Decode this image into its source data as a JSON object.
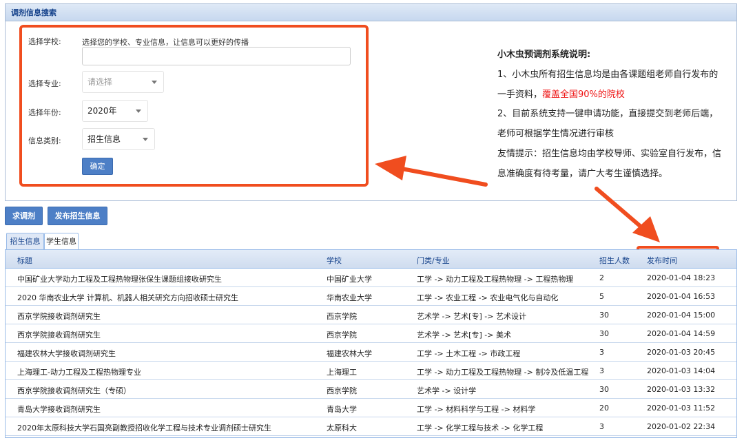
{
  "panel": {
    "title": "调剂信息搜索",
    "hint": "选择您的学校、专业信息，让信息可以更好的传播",
    "labels": {
      "school": "选择学校:",
      "major": "选择专业:",
      "year": "选择年份:",
      "category": "信息类别:"
    },
    "school_value": "",
    "major_placeholder": "请选择",
    "year_value": "2020年",
    "category_value": "招生信息",
    "confirm_label": "确定"
  },
  "description": {
    "title": "小木虫预调剂系统说明:",
    "line1a": "1、小木虫所有招生信息均是由各课题组老师自行发布的",
    "line1b": "一手资料，",
    "line1_highlight": "覆盖全国90%的院校",
    "line2": "2、目前系统支持一键申请功能，直接提交到老师后端，",
    "line2b": "老师可根据学生情况进行审核",
    "line3": "友情提示：招生信息均由学校导师、实验室自行发布，信",
    "line3b": "息准确度有待考量，请广大考生谨慎选择。"
  },
  "actions": {
    "seek": "求调剂",
    "publish": "发布招生信息"
  },
  "tabs": [
    {
      "label": "招生信息"
    },
    {
      "label": "学生信息"
    }
  ],
  "table": {
    "headers": [
      "标题",
      "学校",
      "门类/专业",
      "招生人数",
      "发布时间"
    ],
    "rows": [
      [
        "中国矿业大学动力工程及工程热物理张保生课题组接收研究生",
        "中国矿业大学",
        "工学 -> 动力工程及工程热物理 -> 工程热物理",
        "2",
        "2020-01-04 18:23"
      ],
      [
        "2020 华南农业大学 计算机、机器人相关研究方向招收硕士研究生",
        "华南农业大学",
        "工学 -> 农业工程 -> 农业电气化与自动化",
        "5",
        "2020-01-04 16:53"
      ],
      [
        "西京学院接收调剂研究生",
        "西京学院",
        "艺术学 -> 艺术[专] -> 艺术设计",
        "30",
        "2020-01-04 15:00"
      ],
      [
        "西京学院接收调剂研究生",
        "西京学院",
        "艺术学 -> 艺术[专] -> 美术",
        "30",
        "2020-01-04 14:59"
      ],
      [
        "福建农林大学接收调剂研究生",
        "福建农林大学",
        "工学 -> 土木工程 -> 市政工程",
        "3",
        "2020-01-03 20:45"
      ],
      [
        "上海理工-动力工程及工程热物理专业",
        "上海理工",
        "工学 -> 动力工程及工程热物理 -> 制冷及低温工程",
        "3",
        "2020-01-03 14:04"
      ],
      [
        "西京学院接收调剂研究生（专硕）",
        "西京学院",
        "艺术学 -> 设计学",
        "30",
        "2020-01-03 13:32"
      ],
      [
        "青岛大学接收调剂研究生",
        "青岛大学",
        "工学 -> 材料科学与工程 -> 材料学",
        "20",
        "2020-01-03 11:52"
      ],
      [
        "2020年太原科技大学石国亮副教授招收化学工程与技术专业调剂硕士研究生",
        "太原科大",
        "工学 -> 化学工程与技术 -> 化学工程",
        "3",
        "2020-01-02 22:34"
      ]
    ]
  },
  "colors": {
    "annotation": "#f04d1f",
    "button": "#4d7fc6",
    "highlight": "#ee1111"
  }
}
